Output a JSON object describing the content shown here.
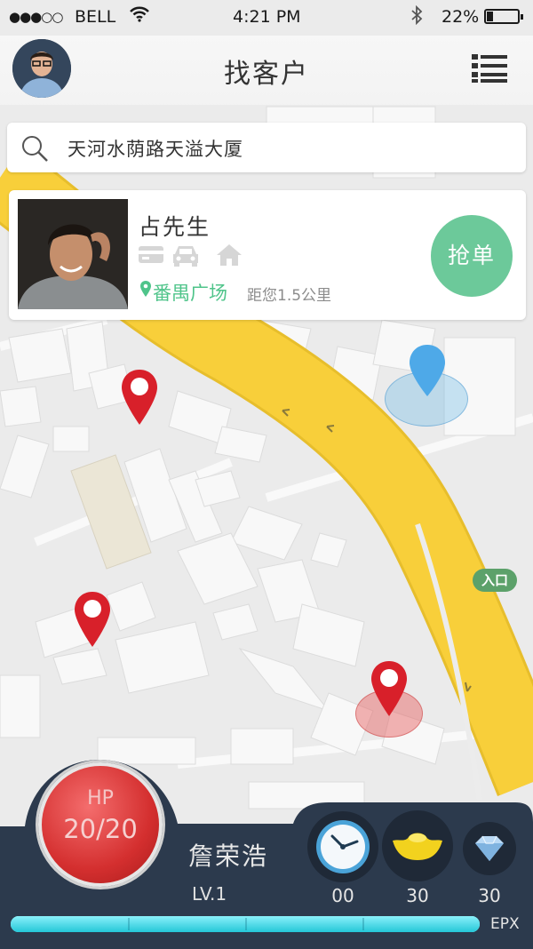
{
  "status_bar": {
    "signal": "●●●○○",
    "carrier": "BELL",
    "time": "4:21 PM",
    "battery_percent": "22%",
    "battery_level": 0.22
  },
  "header": {
    "title": "找客户",
    "avatar_icon": "user-avatar",
    "menu_icon": "list-menu-icon"
  },
  "search": {
    "value": "天河水荫路天溢大厦",
    "icon": "search-icon"
  },
  "customer_card": {
    "name": "占先生",
    "attribute_icons": [
      "credit-card-icon",
      "car-icon",
      "house-icon"
    ],
    "location": "番禺广场",
    "distance": "距您1.5公里",
    "grab_button": "抢单"
  },
  "map": {
    "entrance_label": "入口",
    "colors": {
      "road": "#f8cf3a",
      "pin_red": "#d8202a",
      "pin_blue": "#4ea9e8",
      "building": "#f7f7f7"
    }
  },
  "dashboard": {
    "hp_label": "HP",
    "hp_value": "20/20",
    "player_name": "詹荣浩",
    "level": "LV.1",
    "stats": [
      {
        "icon": "clock-icon",
        "value": "00"
      },
      {
        "icon": "gold-ingot-icon",
        "value": "30"
      },
      {
        "icon": "diamond-icon",
        "value": "30"
      }
    ],
    "xp_label": "EPX",
    "xp_fraction": 1.0,
    "colors": {
      "panel": "#2c3a4d",
      "hp": "#d83535",
      "xp": "#2fd0e0"
    }
  }
}
